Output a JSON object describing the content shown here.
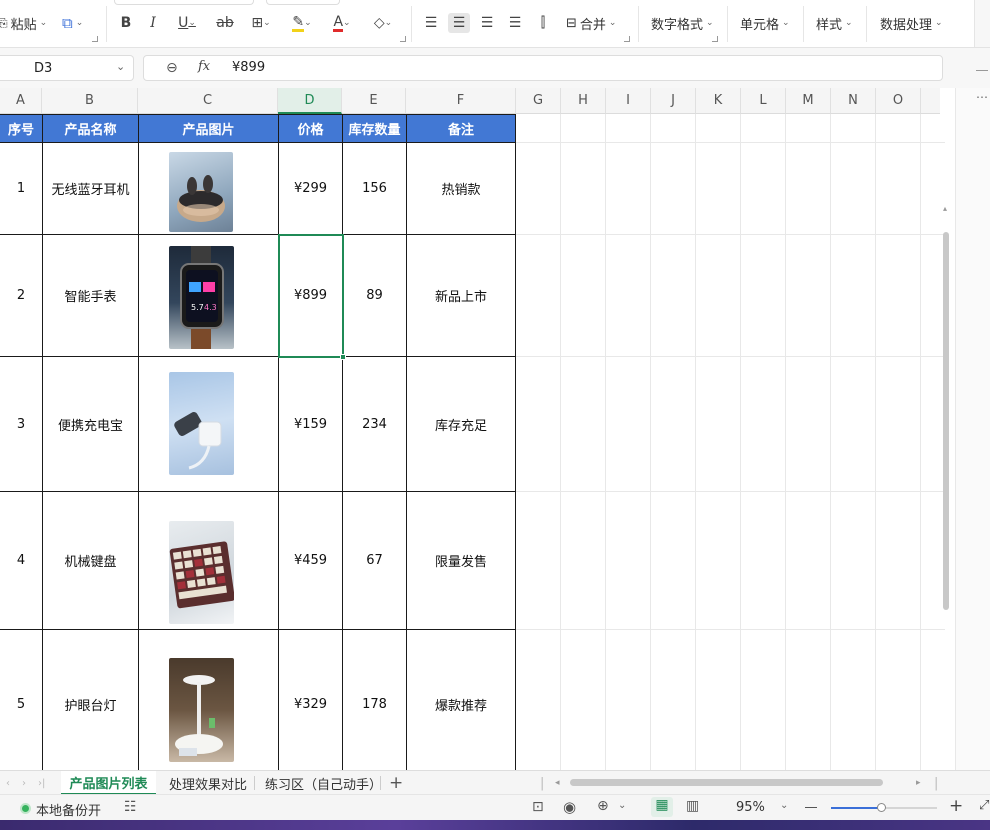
{
  "ribbon": {
    "paste_label": "粘贴",
    "merge_label": "合并",
    "number_format_label": "数字格式",
    "cell_label": "单元格",
    "style_label": "样式",
    "data_processing_label": "数据处理"
  },
  "formula_bar": {
    "cell_ref": "D3",
    "fx_label": "fx",
    "value": "¥899"
  },
  "columns": [
    "A",
    "B",
    "C",
    "D",
    "E",
    "F",
    "G",
    "H",
    "I",
    "J",
    "K",
    "L",
    "M",
    "N",
    "O"
  ],
  "selected_column": "D",
  "table_header": [
    "序号",
    "产品名称",
    "产品图片",
    "价格",
    "库存数量",
    "备注"
  ],
  "rows": [
    {
      "no": "1",
      "name": "无线蓝牙耳机",
      "image": "earbuds-photo",
      "price": "¥299",
      "stock": "156",
      "note": "热销款"
    },
    {
      "no": "2",
      "name": "智能手表",
      "image": "smartwatch-photo",
      "price": "¥899",
      "stock": "89",
      "note": "新品上市"
    },
    {
      "no": "3",
      "name": "便携充电宝",
      "image": "powerbank-photo",
      "price": "¥159",
      "stock": "234",
      "note": "库存充足"
    },
    {
      "no": "4",
      "name": "机械键盘",
      "image": "keyboard-photo",
      "price": "¥459",
      "stock": "67",
      "note": "限量发售"
    },
    {
      "no": "5",
      "name": "护眼台灯",
      "image": "desklamp-photo",
      "price": "¥329",
      "stock": "178",
      "note": "爆款推荐"
    }
  ],
  "watch_face": {
    "left": "5.7",
    "right": "4.3"
  },
  "sheet_tabs": [
    "产品图片列表",
    "处理效果对比",
    "练习区（自己动手）"
  ],
  "active_tab": "产品图片列表",
  "status": {
    "backup_label": "本地备份开",
    "zoom": "95%"
  },
  "colors": {
    "accent": "#1f8a56",
    "header_blue": "#4278d4"
  }
}
